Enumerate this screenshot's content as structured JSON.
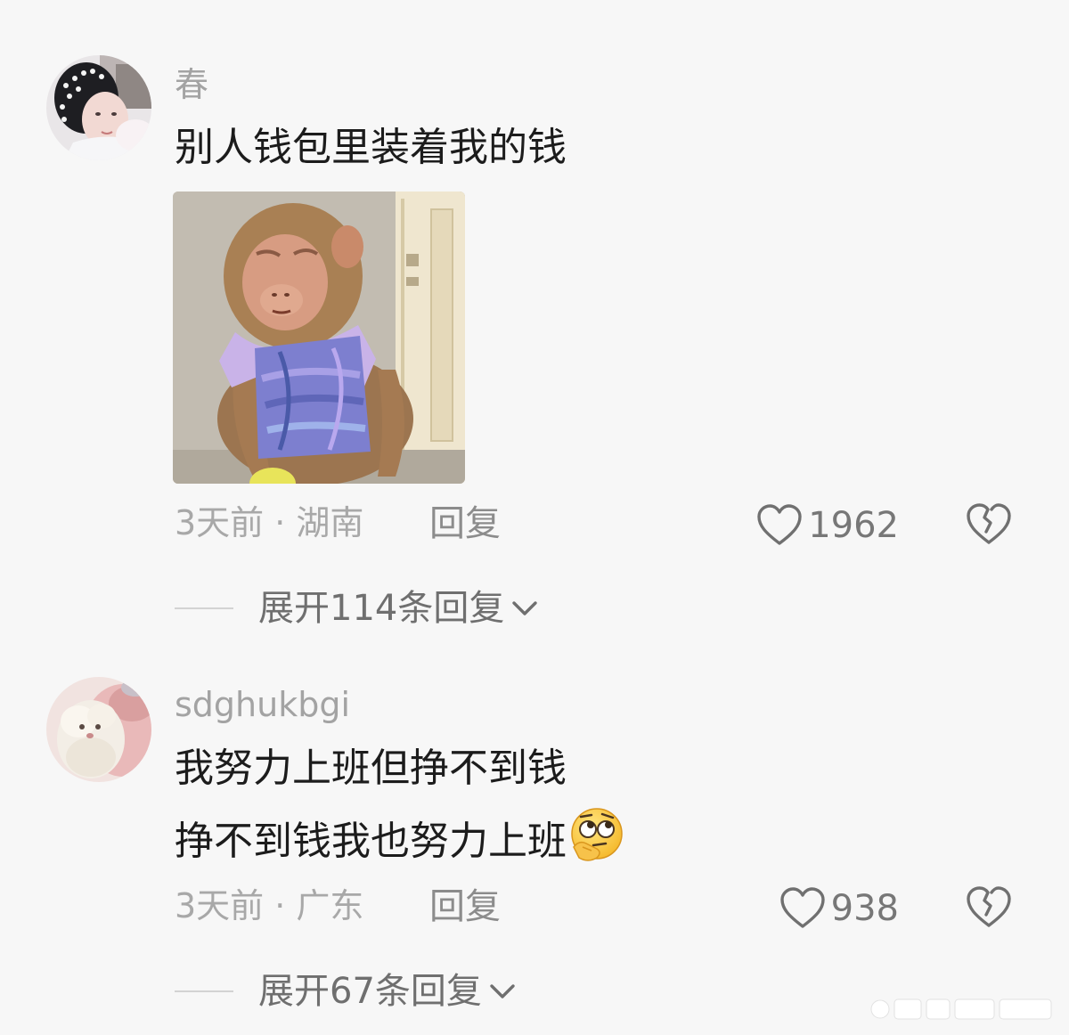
{
  "comments": [
    {
      "username": "春",
      "text_lines": [
        "别人钱包里装着我的钱"
      ],
      "time_location": "3天前 · 湖南",
      "reply_label": "回复",
      "like_count": "1962",
      "expand_label": "展开114条回复"
    },
    {
      "username": "sdghukbgi",
      "text_lines": [
        "我努力上班但挣不到钱",
        "挣不到钱我也努力上班"
      ],
      "emoji": "thinking-rolling-eyes-emoji",
      "time_location": "3天前 · 广东",
      "reply_label": "回复",
      "like_count": "938",
      "expand_label": "展开67条回复"
    }
  ],
  "colors": {
    "background": "#f7f7f7",
    "text_primary": "#1c1c1c",
    "text_secondary": "#a8a8a8",
    "icon": "#777777"
  }
}
